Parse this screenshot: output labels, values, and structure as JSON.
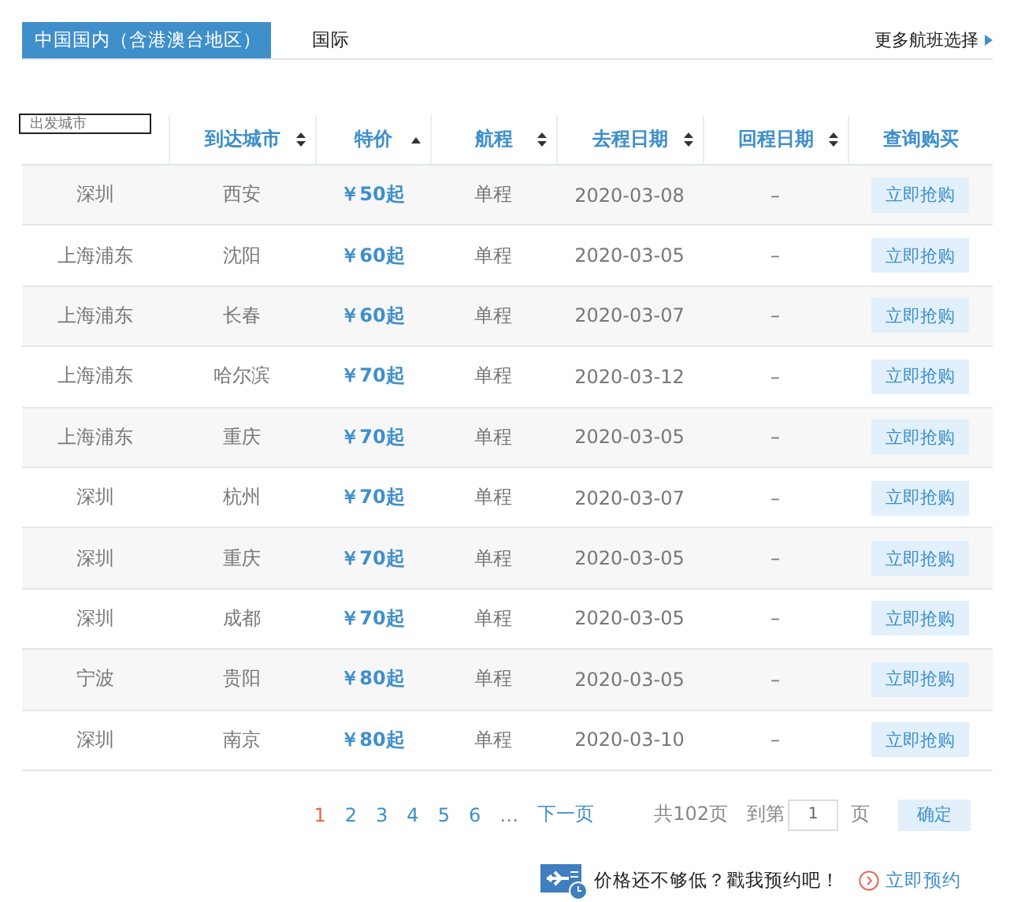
{
  "tabs": [
    {
      "label": "中国国内（含港澳台地区）",
      "selected": true
    },
    {
      "label": "国际",
      "selected": false
    }
  ],
  "more_link": "更多航班选择",
  "table": {
    "origin_filter": {
      "placeholder": "出发城市"
    },
    "columns": [
      {
        "label": "到达城市",
        "sortable": true,
        "sorted_ascending": false
      },
      {
        "label": "特价",
        "sortable": true,
        "sorted_ascending": true
      },
      {
        "label": "航程",
        "sortable": true,
        "sorted_ascending": false
      },
      {
        "label": "去程日期",
        "sortable": true,
        "sorted_ascending": false
      },
      {
        "label": "回程日期",
        "sortable": true,
        "sorted_ascending": false
      },
      {
        "label": "查询购买",
        "sortable": false
      }
    ],
    "rows": [
      {
        "from": "深圳",
        "to": "西安",
        "price": "￥50起",
        "trip": "单程",
        "depart": "2020-03-08",
        "return": "–",
        "action": "立即抢购"
      },
      {
        "from": "上海浦东",
        "to": "沈阳",
        "price": "￥60起",
        "trip": "单程",
        "depart": "2020-03-05",
        "return": "–",
        "action": "立即抢购"
      },
      {
        "from": "上海浦东",
        "to": "长春",
        "price": "￥60起",
        "trip": "单程",
        "depart": "2020-03-07",
        "return": "–",
        "action": "立即抢购"
      },
      {
        "from": "上海浦东",
        "to": "哈尔滨",
        "price": "￥70起",
        "trip": "单程",
        "depart": "2020-03-12",
        "return": "–",
        "action": "立即抢购"
      },
      {
        "from": "上海浦东",
        "to": "重庆",
        "price": "￥70起",
        "trip": "单程",
        "depart": "2020-03-05",
        "return": "–",
        "action": "立即抢购"
      },
      {
        "from": "深圳",
        "to": "杭州",
        "price": "￥70起",
        "trip": "单程",
        "depart": "2020-03-07",
        "return": "–",
        "action": "立即抢购"
      },
      {
        "from": "深圳",
        "to": "重庆",
        "price": "￥70起",
        "trip": "单程",
        "depart": "2020-03-05",
        "return": "–",
        "action": "立即抢购"
      },
      {
        "from": "深圳",
        "to": "成都",
        "price": "￥70起",
        "trip": "单程",
        "depart": "2020-03-05",
        "return": "–",
        "action": "立即抢购"
      },
      {
        "from": "宁波",
        "to": "贵阳",
        "price": "￥80起",
        "trip": "单程",
        "depart": "2020-03-05",
        "return": "–",
        "action": "立即抢购"
      },
      {
        "from": "深圳",
        "to": "南京",
        "price": "￥80起",
        "trip": "单程",
        "depart": "2020-03-10",
        "return": "–",
        "action": "立即抢购"
      }
    ]
  },
  "pagination": {
    "pages": [
      {
        "label": "1",
        "selected": true
      },
      {
        "label": "2",
        "selected": false
      },
      {
        "label": "3",
        "selected": false
      },
      {
        "label": "4",
        "selected": false
      },
      {
        "label": "5",
        "selected": false
      },
      {
        "label": "6",
        "selected": false
      }
    ],
    "ellipsis": "…",
    "next": "下一页",
    "total": "共102页",
    "goto_prefix": "到第",
    "goto_value": "1",
    "goto_suffix": "页",
    "confirm": "确定"
  },
  "reserve": {
    "text": "价格还不够低？戳我预约吧！",
    "link": "立即预约"
  }
}
